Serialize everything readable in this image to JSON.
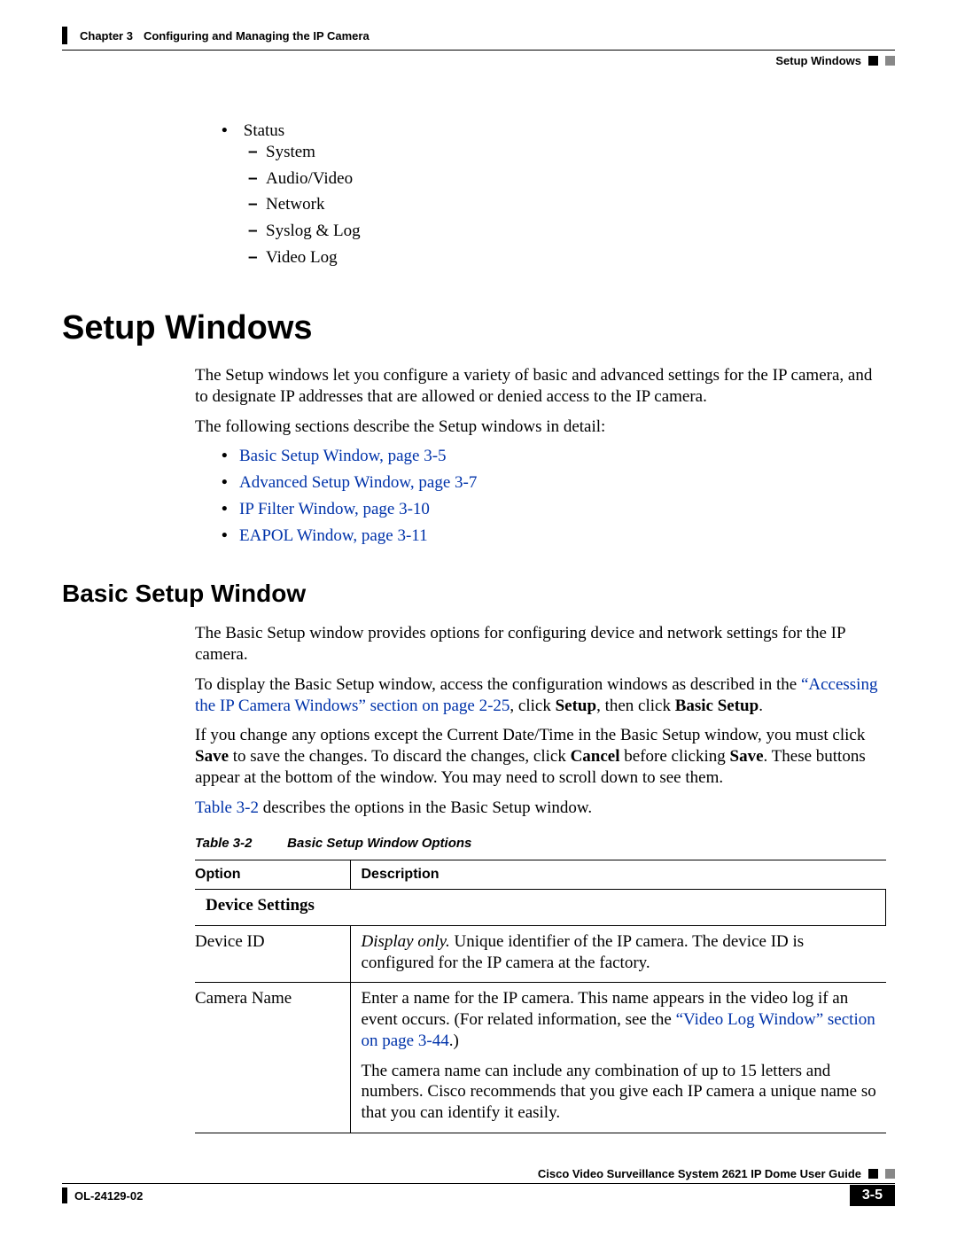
{
  "header": {
    "chapter_label": "Chapter 3",
    "chapter_title": "Configuring and Managing the IP Camera",
    "section_right": "Setup Windows"
  },
  "status_list": {
    "top": "Status",
    "items": [
      "System",
      "Audio/Video",
      "Network",
      "Syslog & Log",
      "Video Log"
    ]
  },
  "h1": "Setup Windows",
  "intro_p1": "The Setup windows let you configure a variety of basic and advanced settings for the IP camera, and to designate IP addresses that are allowed or denied access to the IP camera.",
  "intro_p2": "The following sections describe the Setup windows in detail:",
  "intro_links": [
    "Basic Setup Window, page 3-5",
    "Advanced Setup Window, page 3-7",
    "IP Filter Window, page 3-10",
    "EAPOL Window, page 3-11"
  ],
  "h2": "Basic Setup Window",
  "bsw_p1": "The Basic Setup window provides options for configuring device and network settings for the IP camera.",
  "bsw_p2_a": "To display the Basic Setup window, access the configuration windows as described in the ",
  "bsw_p2_link": "“Accessing the IP Camera Windows” section on page 2-25",
  "bsw_p2_b": ", click ",
  "bsw_p2_setup": "Setup",
  "bsw_p2_c": ", then click ",
  "bsw_p2_basic": "Basic Setup",
  "bsw_p2_d": ".",
  "bsw_p3_a": "If you change any options except the Current Date/Time in the Basic Setup window, you must click ",
  "bsw_p3_save": "Save",
  "bsw_p3_b": " to save the changes. To discard the changes, click ",
  "bsw_p3_cancel": "Cancel",
  "bsw_p3_c": " before clicking ",
  "bsw_p3_save2": "Save",
  "bsw_p3_d": ". These buttons appear at the bottom of the window. You may need to scroll down to see them.",
  "bsw_p4_link": "Table 3-2",
  "bsw_p4_b": " describes the options in the Basic Setup window.",
  "table_caption_label": "Table 3-2",
  "table_caption_title": "Basic Setup Window Options",
  "table": {
    "col1": "Option",
    "col2": "Description",
    "subhead": "Device Settings",
    "row1": {
      "opt": "Device ID",
      "desc_i": "Display only.",
      "desc_r": " Unique identifier of the IP camera. The device ID is configured for the IP camera at the factory."
    },
    "row2": {
      "opt": "Camera Name",
      "p1_a": "Enter a name for the IP camera. This name appears in the video log if an event occurs. (For related information, see the ",
      "p1_link": "“Video Log Window” section on page 3-44",
      "p1_b": ".)",
      "p2": "The camera name can include any combination of up to 15 letters and numbers. Cisco recommends that you give each IP camera a unique name so that you can identify it easily."
    }
  },
  "footer": {
    "guide": "Cisco Video Surveillance System 2621 IP Dome User Guide",
    "ol": "OL-24129-02",
    "page": "3-5"
  }
}
